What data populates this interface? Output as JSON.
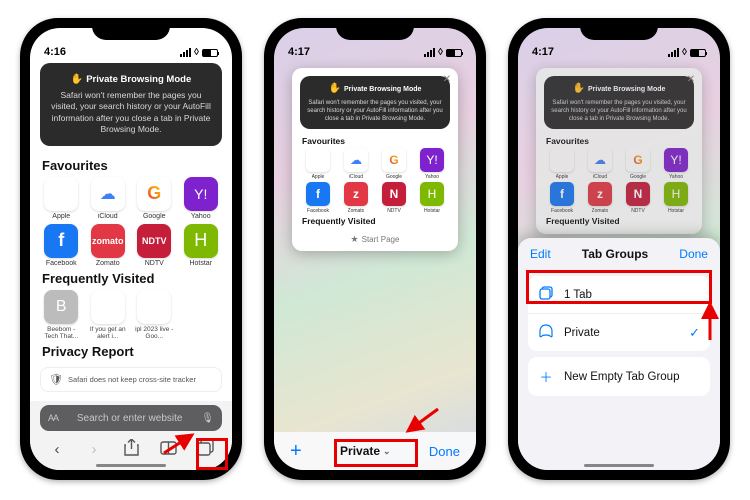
{
  "status": {
    "time1": "4:16",
    "time2": "4:17",
    "time3": "4:17"
  },
  "private_card": {
    "title": "Private Browsing Mode",
    "body": "Safari won't remember the pages you visited, your search history or your AutoFill information after you close a tab in Private Browsing Mode."
  },
  "sections": {
    "favourites": "Favourites",
    "frequently": "Frequently Visited",
    "privacy_report": "Privacy Report"
  },
  "favourites": [
    {
      "label": "Apple"
    },
    {
      "label": "iCloud"
    },
    {
      "label": "Google"
    },
    {
      "label": "Yahoo"
    },
    {
      "label": "Facebook"
    },
    {
      "label": "Zomato"
    },
    {
      "label": "NDTV"
    },
    {
      "label": "Hotstar"
    }
  ],
  "frequent": [
    {
      "label": "Beebom - Tech That..."
    },
    {
      "label": "If you get an alert i..."
    },
    {
      "label": "ipl 2023 live - Goo..."
    }
  ],
  "privacy_line": "Safari does not keep cross-site tracker",
  "search_placeholder": "Search or enter website",
  "thumb_label": "Start Page",
  "tabswitcher": {
    "plus": "+",
    "mode": "Private",
    "done": "Done"
  },
  "sheet": {
    "edit": "Edit",
    "title": "Tab Groups",
    "done": "Done",
    "rows": [
      {
        "label": "1 Tab"
      },
      {
        "label": "Private"
      },
      {
        "label": "New Empty Tab Group"
      }
    ]
  }
}
